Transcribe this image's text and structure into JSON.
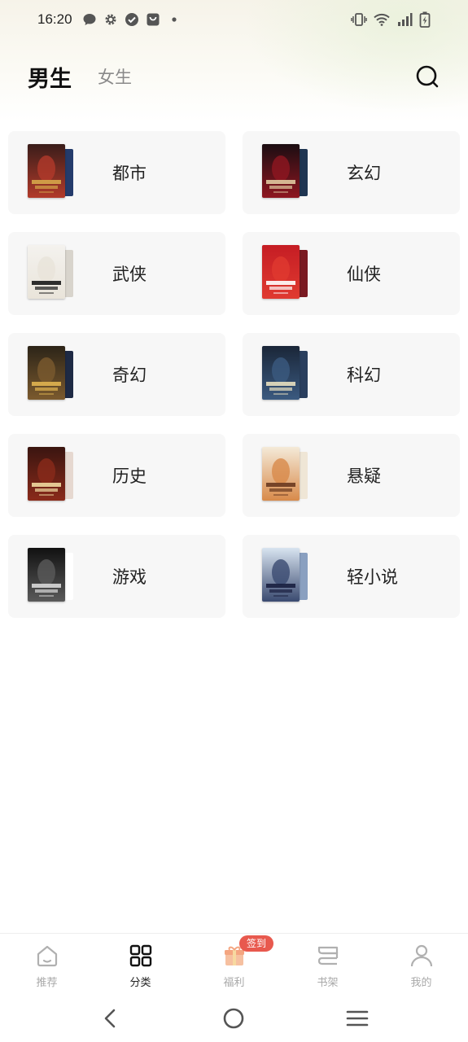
{
  "status_bar": {
    "time": "16:20",
    "left_icons": [
      "chat-bubble-icon",
      "gear-icon",
      "check-circle-icon",
      "bag-icon",
      "dot-icon"
    ],
    "right_icons": [
      "vibrate-icon",
      "wifi-icon",
      "signal-icon",
      "battery-charging-icon"
    ]
  },
  "header": {
    "tabs": [
      {
        "label": "男生",
        "active": true
      },
      {
        "label": "女生",
        "active": false
      }
    ],
    "search_icon": "search-icon"
  },
  "categories": [
    {
      "label": "都市",
      "cover_colors": [
        "#3a1d1a",
        "#b23a2a",
        "#d6a64a"
      ],
      "back_color": "#243b6b"
    },
    {
      "label": "玄幻",
      "cover_colors": [
        "#1b0d12",
        "#8e1620",
        "#e0c8a0"
      ],
      "back_color": "#1f3552"
    },
    {
      "label": "武侠",
      "cover_colors": [
        "#f4f2ee",
        "#e9e4da",
        "#1a1a1a"
      ],
      "back_color": "#d8d4cc"
    },
    {
      "label": "仙侠",
      "cover_colors": [
        "#c51d24",
        "#e03a30",
        "#ffffff"
      ],
      "back_color": "#7a1a22"
    },
    {
      "label": "奇幻",
      "cover_colors": [
        "#2c2418",
        "#7b5a2e",
        "#e0b450"
      ],
      "back_color": "#1e2a44"
    },
    {
      "label": "科幻",
      "cover_colors": [
        "#1a2638",
        "#3b5a80",
        "#e8e0c0"
      ],
      "back_color": "#2a3f5e"
    },
    {
      "label": "历史",
      "cover_colors": [
        "#3a1510",
        "#8a2a1a",
        "#f0d9a0"
      ],
      "back_color": "#e6d8d0"
    },
    {
      "label": "悬疑",
      "cover_colors": [
        "#f4ead8",
        "#d88a4a",
        "#6a3a20"
      ],
      "back_color": "#efe6d6"
    },
    {
      "label": "游戏",
      "cover_colors": [
        "#111111",
        "#5a5a5a",
        "#d8d8d8"
      ],
      "back_color": "#ffffff"
    },
    {
      "label": "轻小说",
      "cover_colors": [
        "#d8e4f0",
        "#3a4a70",
        "#1a2040"
      ],
      "back_color": "#8aa0c0"
    }
  ],
  "bottom_nav": [
    {
      "label": "推荐",
      "icon": "home-icon",
      "active": false
    },
    {
      "label": "分类",
      "icon": "grid-icon",
      "active": true
    },
    {
      "label": "福利",
      "icon": "gift-icon",
      "active": false,
      "badge": "签到"
    },
    {
      "label": "书架",
      "icon": "bookshelf-icon",
      "active": false
    },
    {
      "label": "我的",
      "icon": "user-icon",
      "active": false
    }
  ],
  "system_nav": [
    "back-icon",
    "home-circle-icon",
    "menu-icon"
  ],
  "colors": {
    "accent_badge": "#e8594e",
    "card_bg": "#f7f7f7",
    "inactive_nav": "#a9a9a9",
    "active_nav": "#222222"
  }
}
